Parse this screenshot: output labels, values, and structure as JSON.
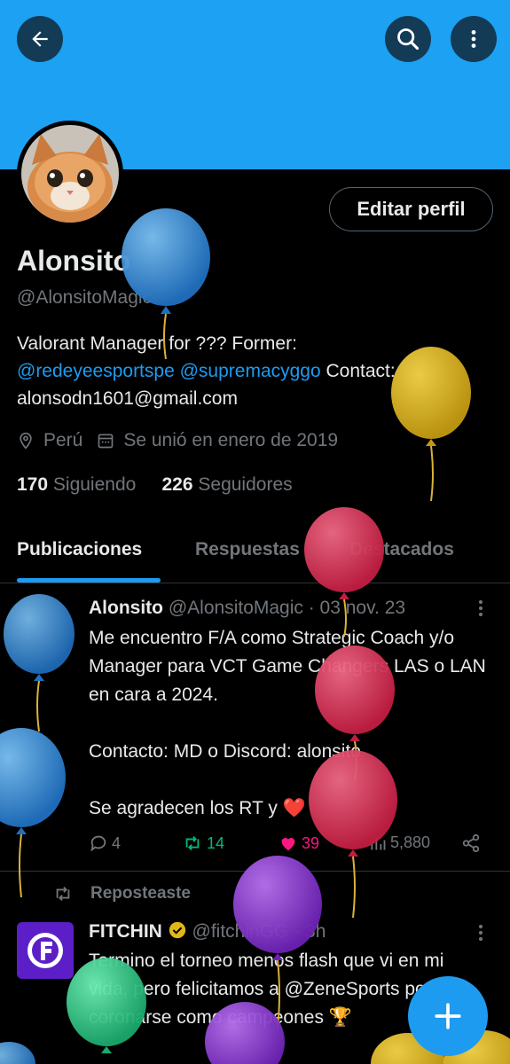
{
  "header": {
    "back_icon": "arrow-left-icon",
    "search_icon": "search-icon",
    "more_icon": "more-vertical-icon",
    "banner_color": "#1da1f2"
  },
  "profile": {
    "edit_label": "Editar perfil",
    "display_name": "Alonsito",
    "handle": "@AlonsitoMagic",
    "bio_prefix": "Valorant Manager for ??? Former:",
    "bio_link1": "@redeyeesportspe",
    "bio_link2": "@supremacyggo",
    "bio_contact": "Contact:",
    "bio_email": "alonsodn1601@gmail.com",
    "location": "Perú",
    "joined": "Se unió en enero de 2019",
    "following_count": "170",
    "following_label": "Siguiendo",
    "followers_count": "226",
    "followers_label": "Seguidores"
  },
  "tabs": [
    {
      "label": "Publicaciones",
      "active": true
    },
    {
      "label": "Respuestas",
      "active": false
    },
    {
      "label": "Destacados",
      "active": false
    }
  ],
  "tweet1": {
    "name": "Alonsito",
    "handle": "@AlonsitoMagic",
    "date": "· 03 nov. 23",
    "text": "Me encuentro F/A como Strategic Coach y/o Manager para VCT Game Changers LAS o LAN en cara a 2024.\n\nContacto: MD o Discord: alonsito\n\nSe agradecen los RT y ❤️",
    "replies": "4",
    "reposts": "14",
    "likes": "39",
    "views": "5,880"
  },
  "repost_label": "Reposteaste",
  "tweet2": {
    "name": "FITCHIN",
    "handle": "@fitchinGG",
    "date": "· 3h",
    "text": "Termino el torneo menos flash que vi en mi vida, pero felicitamos a @ZeneSports por coronarse como campeones 🏆"
  },
  "fab_icon": "plus-icon",
  "colors": {
    "accent": "#1d9bf0",
    "repost_green": "#00ba7c",
    "like_pink": "#f91880",
    "balloon_blue": "#3b8fd9",
    "balloon_yellow": "#e0b422",
    "balloon_red": "#e0365a",
    "balloon_purple": "#8e3ad6",
    "balloon_green": "#2fc98a"
  }
}
